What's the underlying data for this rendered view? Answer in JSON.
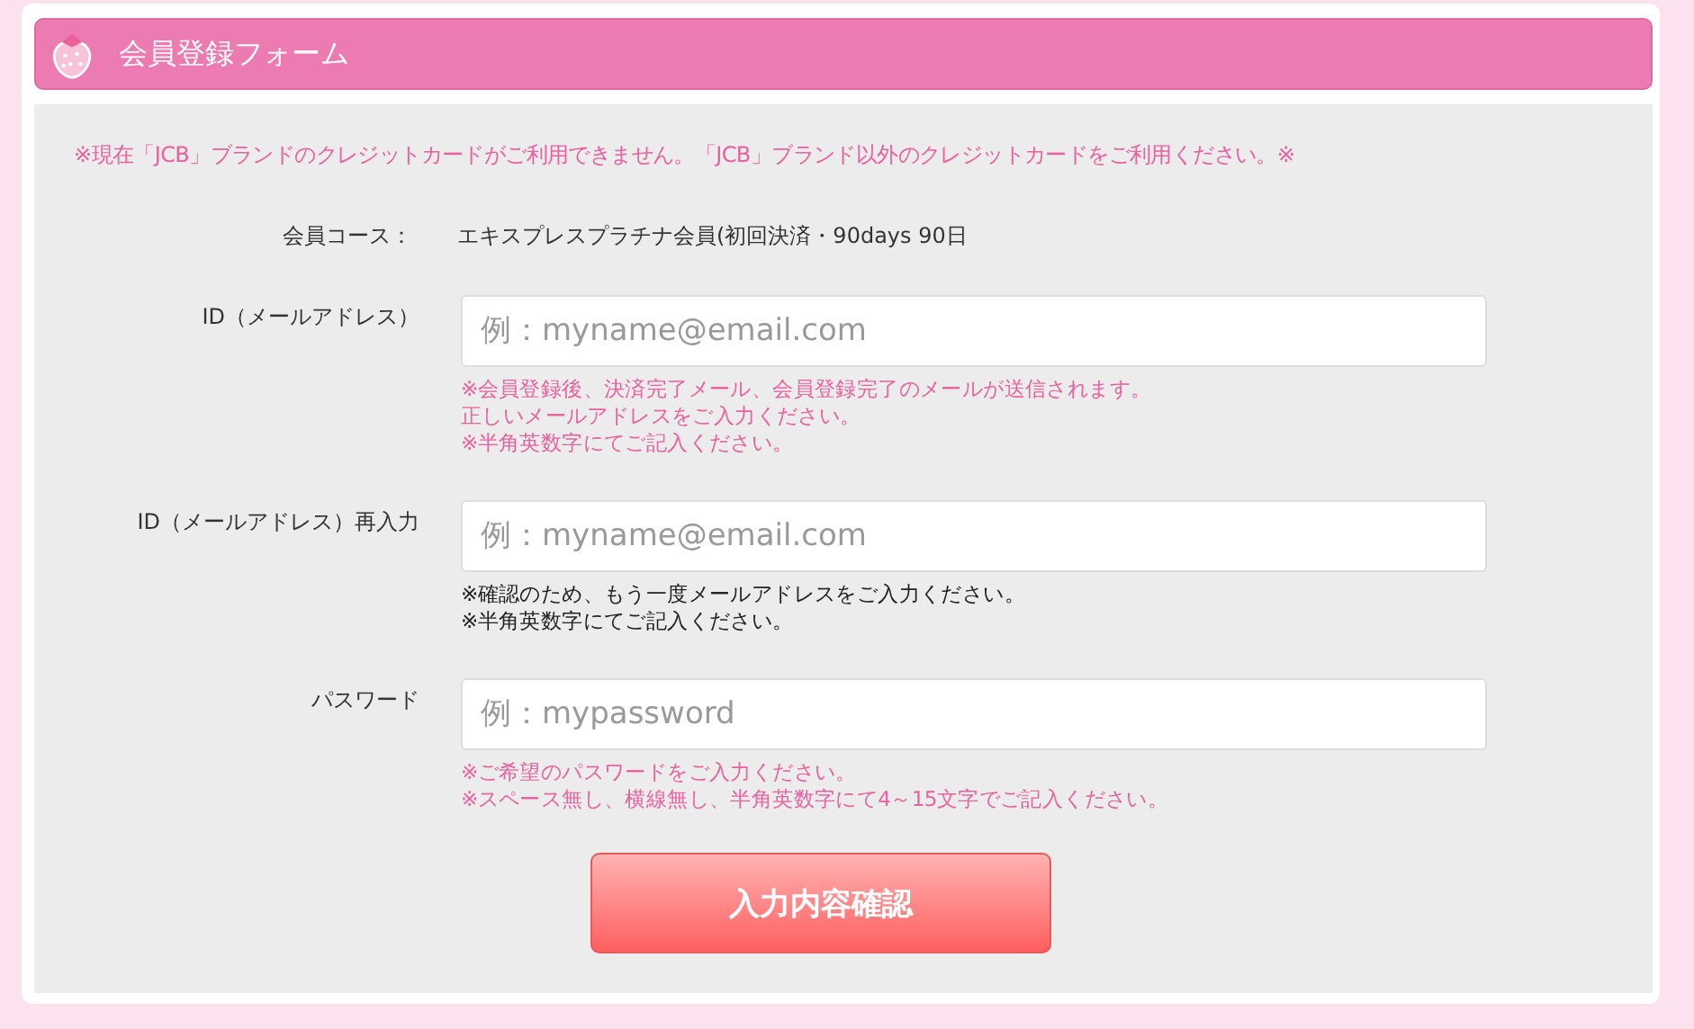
{
  "header": {
    "title": "会員登録フォーム"
  },
  "notice": "※現在「JCB」ブランドのクレジットカードがご利用できません。「JCB」ブランド以外のクレジットカードをご利用ください。※",
  "course": {
    "label": "会員コース：",
    "value": "エキスプレスプラチナ会員(初回決済・90days 90日"
  },
  "fields": [
    {
      "label": "ID（メールアドレス）",
      "placeholder": "例：myname@email.com",
      "notes": [
        {
          "kind": "alert",
          "text": "※会員登録後、決済完了メール、会員登録完了のメールが送信されます。"
        },
        {
          "kind": "alert",
          "text": "正しいメールアドレスをご入力ください。"
        },
        {
          "kind": "alert",
          "text": "※半角英数字にてご記入ください。"
        }
      ]
    },
    {
      "label": "ID（メールアドレス）再入力",
      "placeholder": "例：myname@email.com",
      "notes": [
        {
          "kind": "info",
          "text": "※確認のため、もう一度メールアドレスをご入力ください。"
        },
        {
          "kind": "info",
          "text": "※半角英数字にてご記入ください。"
        }
      ]
    },
    {
      "label": "パスワード",
      "placeholder": "例：mypassword",
      "notes": [
        {
          "kind": "alert",
          "text": "※ご希望のパスワードをご入力ください。"
        },
        {
          "kind": "alert",
          "text": "※スペース無し、横線無し、半角英数字にて4～15文字でご記入ください。"
        }
      ]
    }
  ],
  "submit": "入力内容確認"
}
